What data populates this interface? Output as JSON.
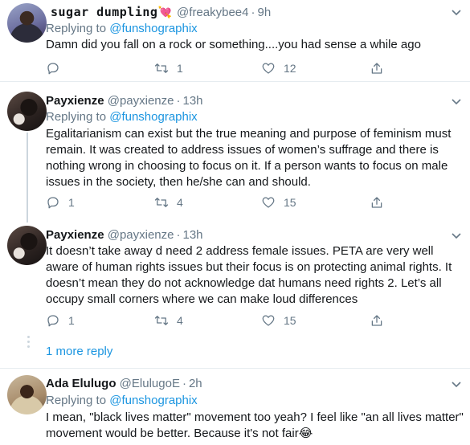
{
  "tweets": [
    {
      "name": "sugar dumpling",
      "name_emoji": "💘",
      "handle": "@freakybee4",
      "time": "9h",
      "replying_label": "Replying to",
      "replying_handle": "@funshographix",
      "text": "Damn did you fall on a rock or something....you had sense a while ago",
      "replies": "",
      "retweets": "1",
      "likes": "12"
    },
    {
      "name": "Payxienze",
      "handle": "@payxienze",
      "time": "13h",
      "replying_label": "Replying to",
      "replying_handle": "@funshographix",
      "text": "Egalitarianism can exist but the true meaning and purpose of feminism must remain. It was created to address issues of women’s suffrage and there is nothing wrong in choosing to focus on it. If a person wants to focus on male issues in the society, then he/she can and should.",
      "replies": "1",
      "retweets": "4",
      "likes": "15"
    },
    {
      "name": "Payxienze",
      "handle": "@payxienze",
      "time": "13h",
      "text": "It doesn’t take away d need 2 address female issues. PETA are very well aware of human rights issues but their focus is on protecting animal rights. It doesn’t mean they do not acknowledge dat humans need rights 2. Let’s all occupy small corners where we can make loud differences",
      "replies": "1",
      "retweets": "4",
      "likes": "15"
    },
    {
      "name": "Ada Elulugo",
      "handle": "@ElulugoE",
      "time": "2h",
      "replying_label": "Replying to",
      "replying_handle": "@funshographix",
      "text": "I mean, \"black lives matter\" movement too yeah? I feel like \"an all lives matter\" movement would be better. Because it's not fair😂"
    }
  ],
  "more_replies": "1 more reply",
  "colors": {
    "link": "#1b95e0",
    "muted": "#657786",
    "separator": "#e6ecf0",
    "heart": "#e0245e"
  }
}
